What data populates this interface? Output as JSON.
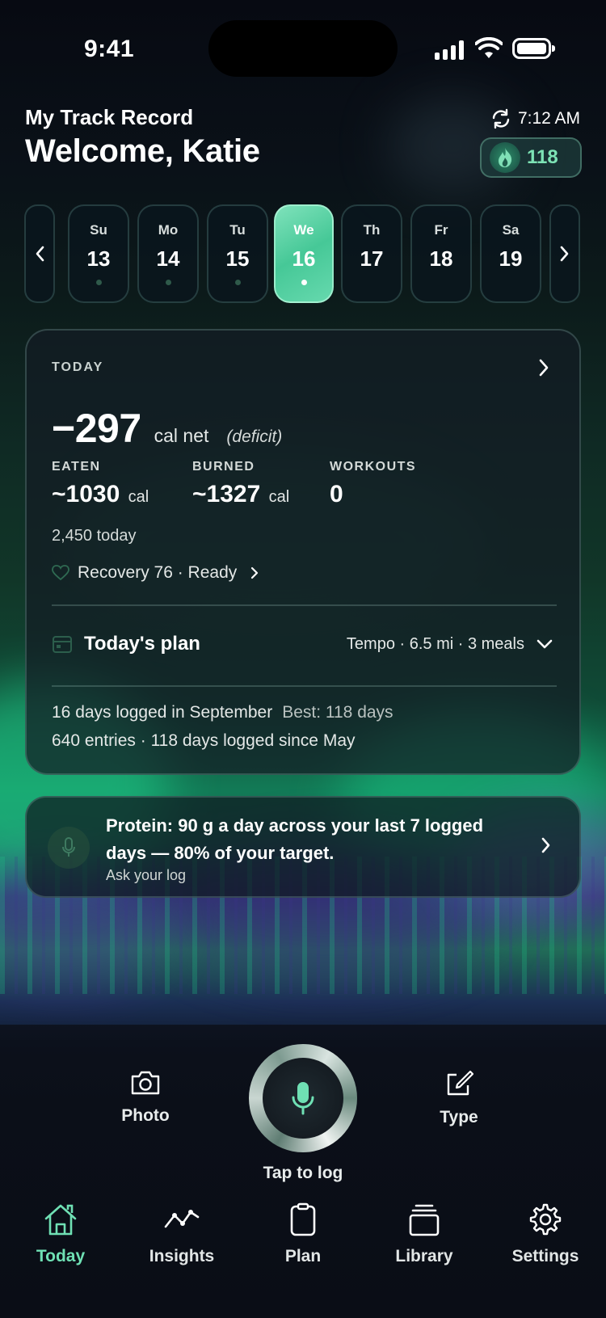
{
  "status": {
    "time": "9:41"
  },
  "header": {
    "subtitle": "My Track Record",
    "title": "Welcome, Katie",
    "sync_time": "7:12 AM",
    "streak_count": "118"
  },
  "week": {
    "days": [
      {
        "name": "Su",
        "date": "13",
        "logged": true
      },
      {
        "name": "Mo",
        "date": "14",
        "logged": true
      },
      {
        "name": "Tu",
        "date": "15",
        "logged": true
      },
      {
        "name": "We",
        "date": "16",
        "logged": true,
        "selected": true
      },
      {
        "name": "Th",
        "date": "17",
        "logged": false
      },
      {
        "name": "Fr",
        "date": "18",
        "logged": false
      },
      {
        "name": "Sa",
        "date": "19",
        "logged": false
      }
    ]
  },
  "today": {
    "label": "TODAY",
    "net_value": "−297",
    "net_unit": "cal net",
    "net_note": "(deficit)",
    "eaten_label": "EATEN",
    "eaten_value": "~1030",
    "eaten_unit": "cal",
    "burned_label": "BURNED",
    "burned_value": "~1327",
    "burned_unit": "cal",
    "workouts_label": "WORKOUTS",
    "workouts_value": "0",
    "budget": "2,450 today",
    "recovery": "Recovery 76 · Ready",
    "plan_title": "Today's plan",
    "plan_detail": "Tempo · 6.5 mi · 3 meals",
    "logged_month": "16 days logged in September",
    "logged_best": "Best: 118 days",
    "logged_total": "640 entries · 118 days logged since May"
  },
  "insight": {
    "message": "Protein: 90 g a day across your last 7 logged days — 80% of your target.",
    "ask": "Ask your log"
  },
  "capture": {
    "photo_label": "Photo",
    "type_label": "Type",
    "tap_label": "Tap to log"
  },
  "tabs": [
    {
      "label": "Today",
      "icon": "home-icon",
      "active": true
    },
    {
      "label": "Insights",
      "icon": "chart-icon"
    },
    {
      "label": "Plan",
      "icon": "clipboard-icon"
    },
    {
      "label": "Library",
      "icon": "stack-icon"
    },
    {
      "label": "Settings",
      "icon": "gear-icon"
    }
  ],
  "colors": {
    "accent": "#6fe0b4",
    "selected_day": "#4fcb9b"
  }
}
